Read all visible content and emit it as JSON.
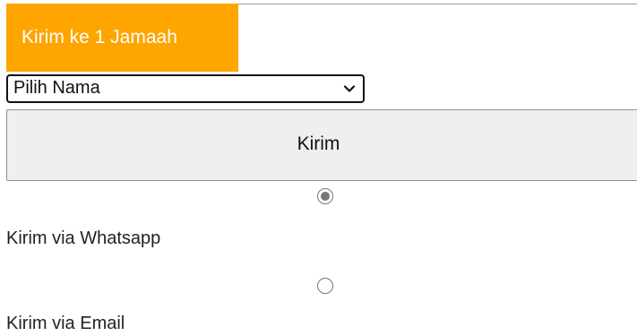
{
  "header": {
    "title": "Kirim ke 1 Jamaah",
    "accent_color": "#ffa500"
  },
  "recipient_select": {
    "selected": "Pilih Nama",
    "icon": "chevron-down-icon"
  },
  "submit_button": {
    "label": "Kirim"
  },
  "send_options": [
    {
      "label": "Kirim via Whatsapp",
      "checked": true
    },
    {
      "label": "Kirim via Email",
      "checked": false
    }
  ]
}
